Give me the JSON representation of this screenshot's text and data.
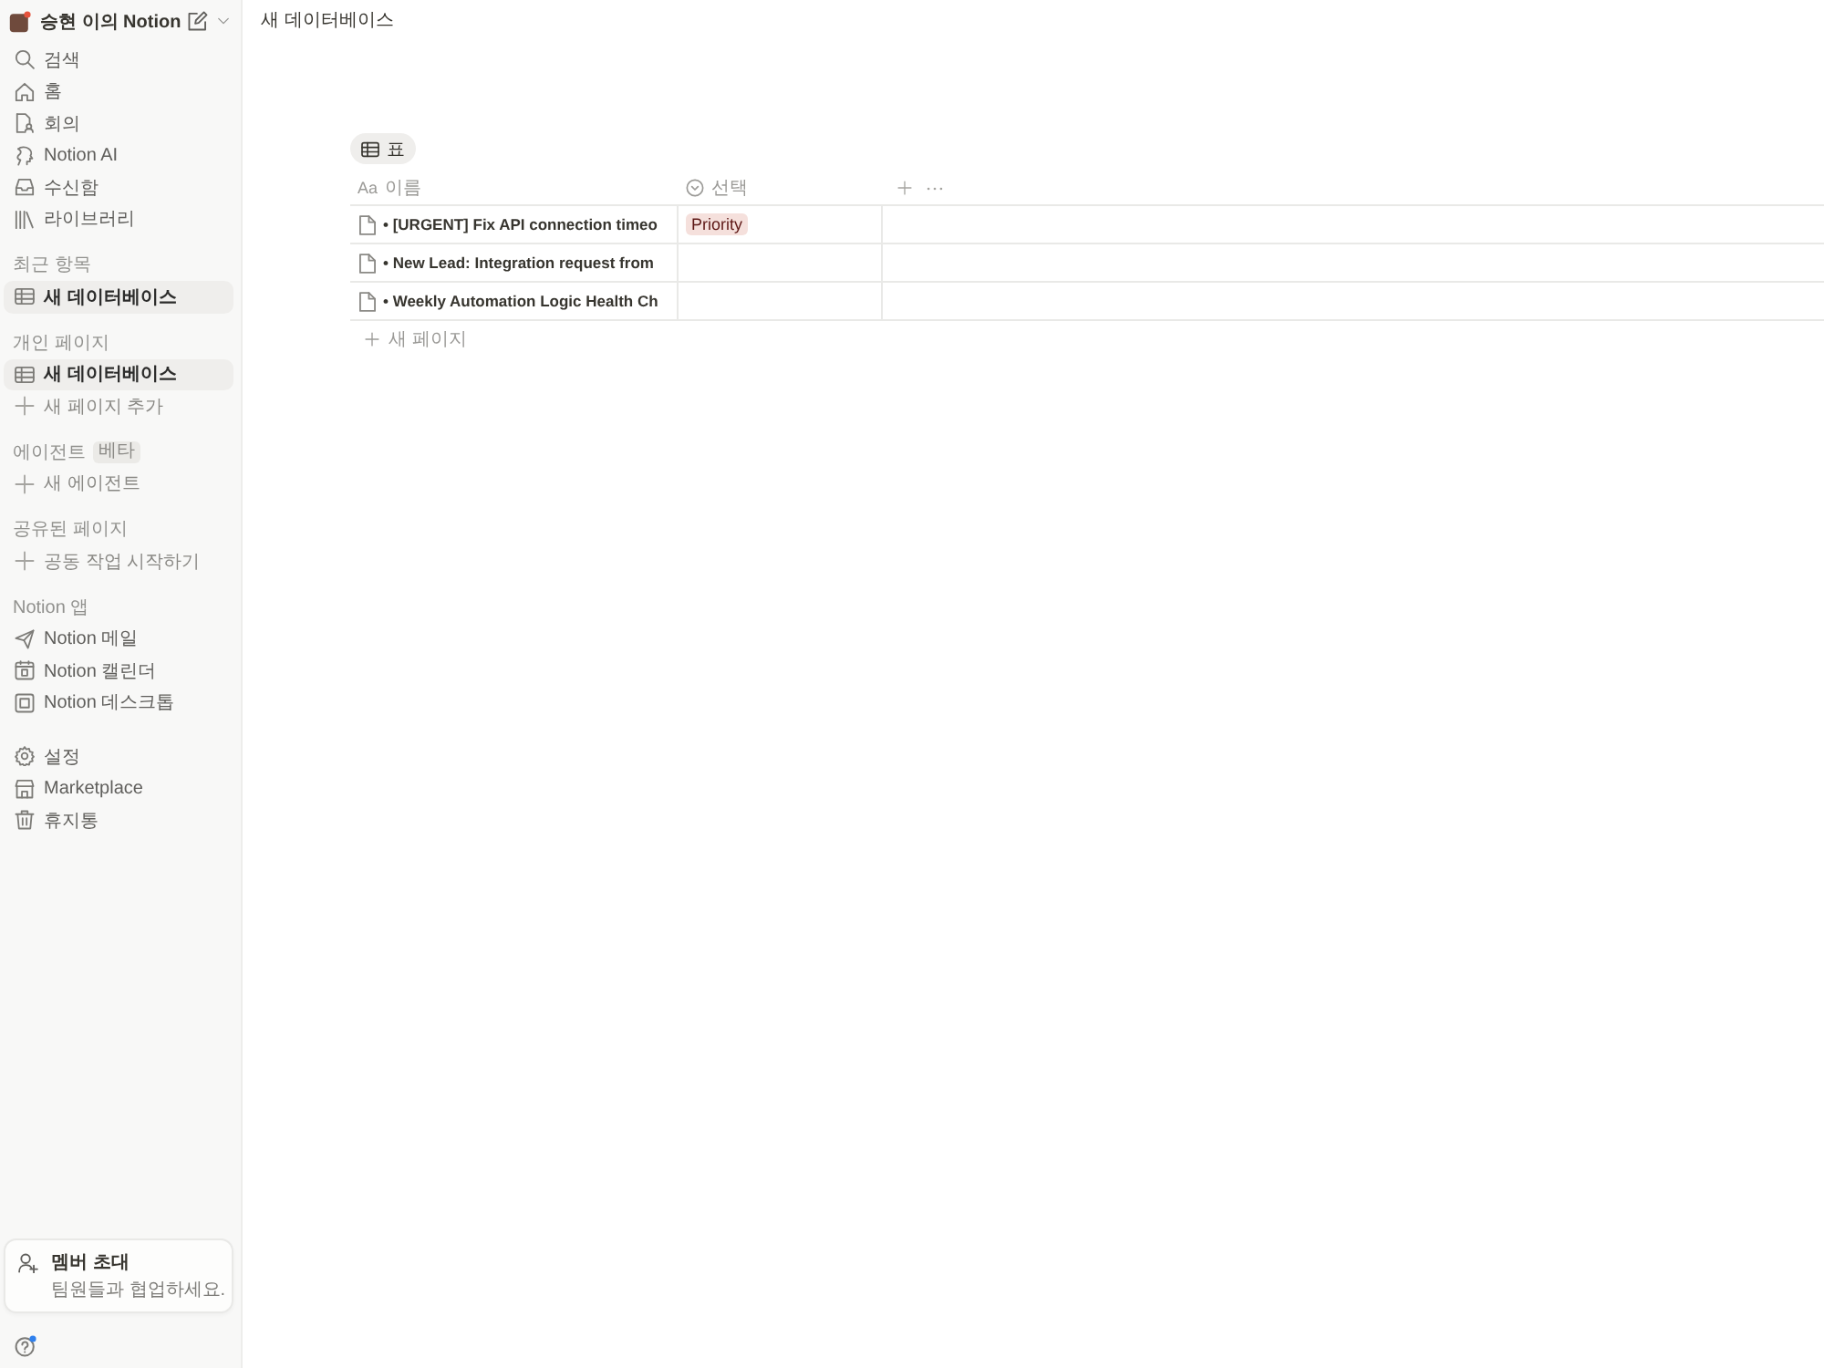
{
  "sidebar": {
    "workspace": {
      "name": "승현 이의 Notion"
    },
    "nav": [
      {
        "label": "검색",
        "selected": false
      },
      {
        "label": "홈",
        "selected": false
      },
      {
        "label": "회의",
        "selected": false
      },
      {
        "label": "Notion AI",
        "selected": false
      },
      {
        "label": "수신함",
        "selected": false
      },
      {
        "label": "라이브러리",
        "selected": false
      }
    ],
    "sections": [
      {
        "title": "최근 항목",
        "items": [
          {
            "kind": "page",
            "label": "새 데이터베이스",
            "selected": true
          }
        ]
      },
      {
        "title": "개인 페이지",
        "items": [
          {
            "kind": "page",
            "label": "새 데이터베이스",
            "selected": true
          },
          {
            "kind": "add",
            "label": "새 페이지 추가",
            "selected": false
          }
        ]
      },
      {
        "title": "에이전트",
        "badge": "베타",
        "items": [
          {
            "kind": "add",
            "label": "새 에이전트",
            "selected": false
          }
        ]
      },
      {
        "title": "공유된 페이지",
        "items": [
          {
            "kind": "add",
            "label": "공동 작업 시작하기",
            "selected": false
          }
        ]
      },
      {
        "title": "Notion 앱",
        "items": [
          {
            "kind": "app",
            "label": "Notion 메일",
            "selected": false
          },
          {
            "kind": "app",
            "label": "Notion 캘린더",
            "selected": false
          },
          {
            "kind": "app",
            "label": "Notion 데스크톱",
            "selected": false
          }
        ]
      }
    ],
    "footer_items": [
      {
        "label": "설정",
        "selected": false
      },
      {
        "label": "Marketplace",
        "selected": false
      },
      {
        "label": "휴지통",
        "selected": false
      }
    ],
    "invite_card": {
      "title": "멤버 초대",
      "subtitle": "팀원들과 협업하세요."
    }
  },
  "breadcrumb": "새 데이터베이스",
  "view_tabs": [
    {
      "label": "표",
      "selected": true
    }
  ],
  "table": {
    "columns": [
      {
        "kind": "text",
        "type_label": "Aa",
        "label": "이름"
      },
      {
        "kind": "select",
        "label": "선택"
      }
    ],
    "rows": [
      {
        "title": "• [URGENT] Fix API connection timeo",
        "select": {
          "label": "Priority",
          "color": "#f5e0dc"
        }
      },
      {
        "title": "• New Lead: Integration request from"
      },
      {
        "title": "• Weekly Automation Logic Health Ch"
      }
    ],
    "new_row_label": "새 페이지"
  }
}
